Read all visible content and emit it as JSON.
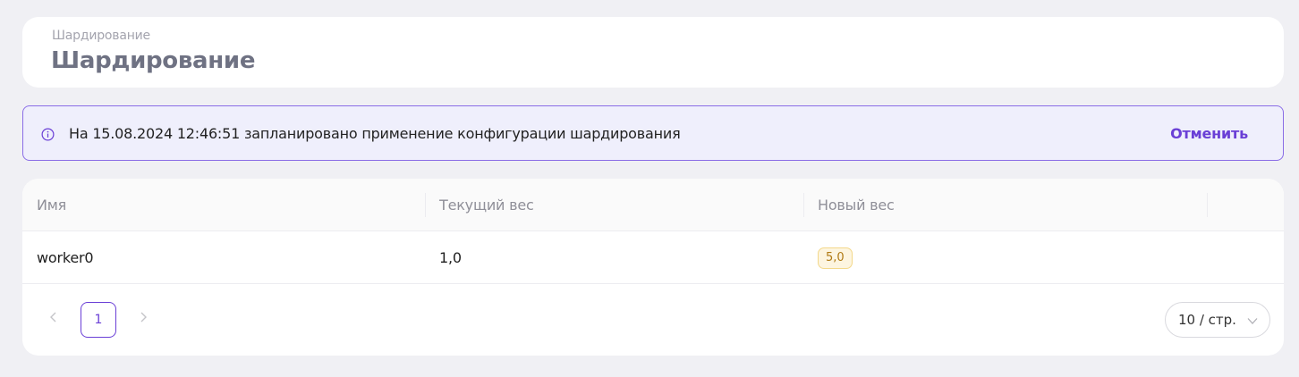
{
  "header": {
    "breadcrumb": "Шардирование",
    "title": "Шардирование"
  },
  "alert": {
    "icon": "info-icon",
    "message": "На 15.08.2024 12:46:51 запланировано применение конфигурации шардирования",
    "action_label": "Отменить",
    "accent_color": "#6a3fd6"
  },
  "table": {
    "columns": [
      "Имя",
      "Текущий вес",
      "Новый вес"
    ],
    "rows": [
      {
        "name": "worker0",
        "current_weight": "1,0",
        "new_weight": "5,0"
      }
    ]
  },
  "pagination": {
    "current_page": "1",
    "page_size_label": "10 / стр.",
    "prev_icon": "chevron-left-icon",
    "next_icon": "chevron-right-icon"
  }
}
